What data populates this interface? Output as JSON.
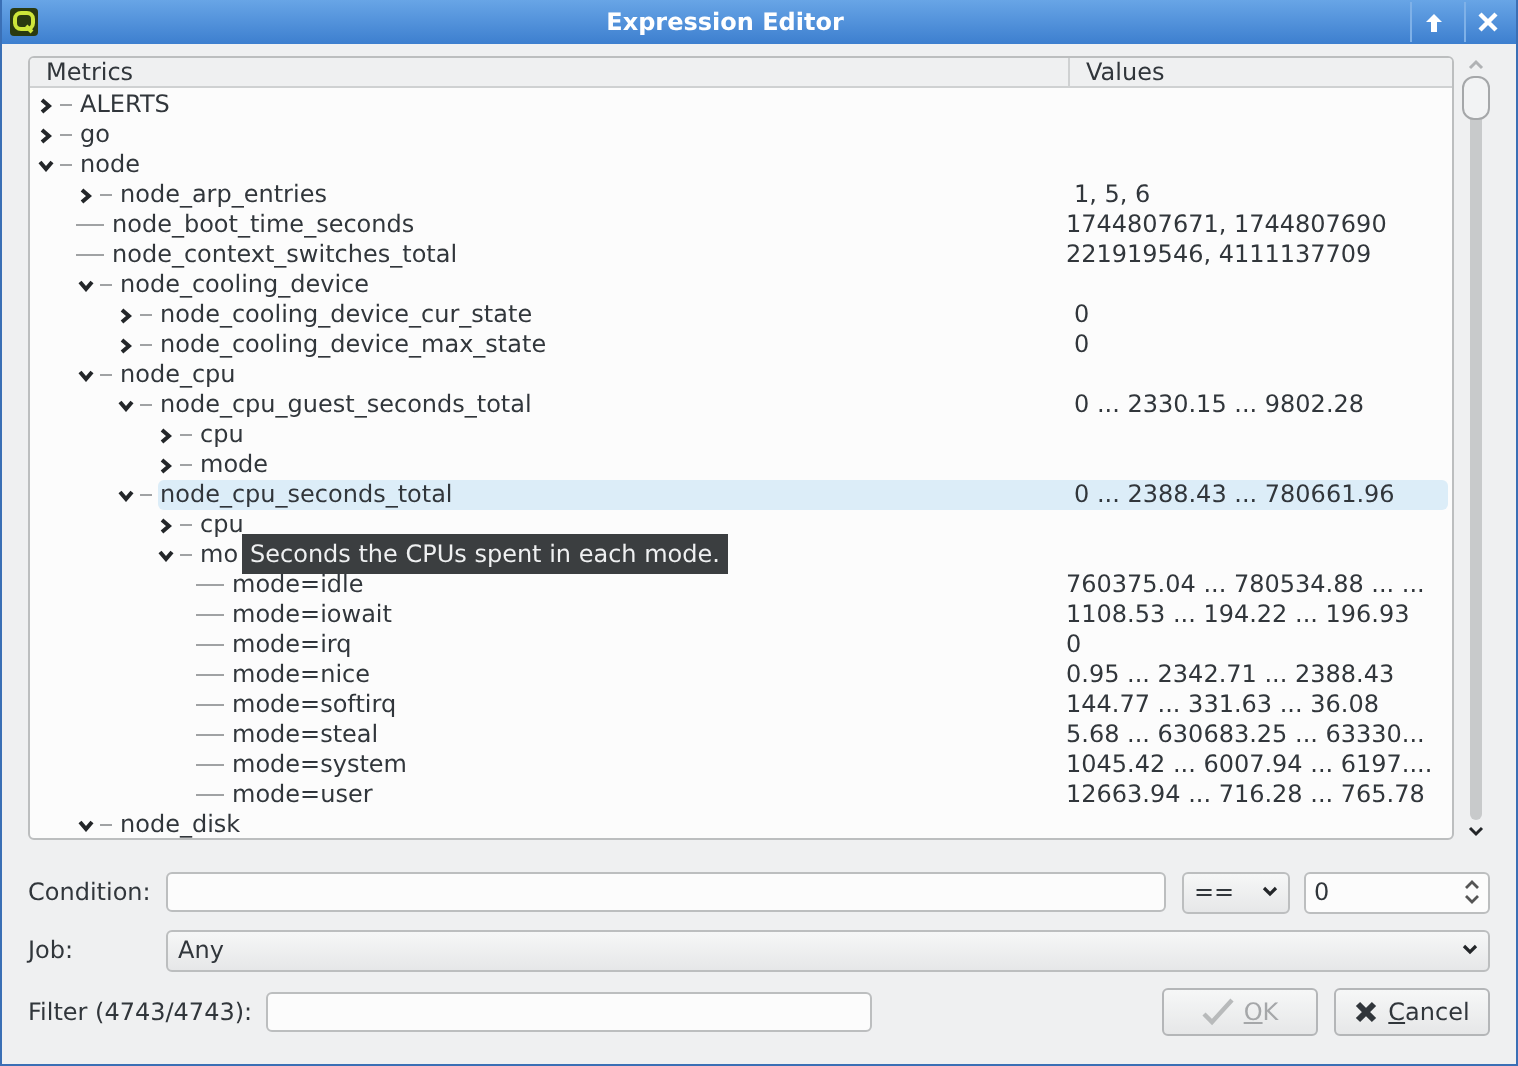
{
  "window": {
    "title": "Expression Editor"
  },
  "tree": {
    "columns": [
      "Metrics",
      "Values"
    ],
    "items": [
      {
        "label": "ALERTS",
        "expanded": false,
        "selected": false
      },
      {
        "label": "go",
        "expanded": false,
        "selected": false
      },
      {
        "label": "node",
        "expanded": true,
        "selected": false,
        "children": [
          {
            "label": "node_arp_entries",
            "value": "1, 5, 6",
            "expanded": false,
            "selected": false
          },
          {
            "label": "node_boot_time_seconds",
            "value": "1744807671, 1744807690",
            "selected": false
          },
          {
            "label": "node_context_switches_total",
            "value": "221919546, 4111137709",
            "selected": false
          },
          {
            "label": "node_cooling_device",
            "expanded": true,
            "selected": false,
            "children": [
              {
                "label": "node_cooling_device_cur_state",
                "value": "0",
                "expanded": false,
                "selected": false
              },
              {
                "label": "node_cooling_device_max_state",
                "value": "0",
                "expanded": false,
                "selected": false
              }
            ]
          },
          {
            "label": "node_cpu",
            "expanded": true,
            "selected": false,
            "children": [
              {
                "label": "node_cpu_guest_seconds_total",
                "value": "0 ... 2330.15 ... 9802.28",
                "expanded": true,
                "selected": false,
                "children": [
                  {
                    "label": "cpu",
                    "expanded": false,
                    "selected": false
                  },
                  {
                    "label": "mode",
                    "expanded": false,
                    "selected": false
                  }
                ]
              },
              {
                "label": "node_cpu_seconds_total",
                "value": "0 ... 2388.43 ... 780661.96",
                "expanded": true,
                "selected": true,
                "children": [
                  {
                    "label": "cpu",
                    "expanded": false,
                    "selected": false
                  },
                  {
                    "label": "mo",
                    "expanded": true,
                    "selected": false,
                    "children": [
                      {
                        "label": "mode=idle",
                        "value": "760375.04 ... 780534.88 ... ...",
                        "selected": false
                      },
                      {
                        "label": "mode=iowait",
                        "value": "1108.53 ... 194.22 ... 196.93",
                        "selected": false
                      },
                      {
                        "label": "mode=irq",
                        "value": "0",
                        "selected": false
                      },
                      {
                        "label": "mode=nice",
                        "value": "0.95 ... 2342.71 ... 2388.43",
                        "selected": false
                      },
                      {
                        "label": "mode=softirq",
                        "value": "144.77 ... 331.63 ... 36.08",
                        "selected": false
                      },
                      {
                        "label": "mode=steal",
                        "value": "5.68 ... 630683.25 ... 63330...",
                        "selected": false
                      },
                      {
                        "label": "mode=system",
                        "value": "1045.42 ... 6007.94 ... 6197....",
                        "selected": false
                      },
                      {
                        "label": "mode=user",
                        "value": "12663.94 ... 716.28 ... 765.78",
                        "selected": false
                      }
                    ]
                  }
                ]
              }
            ]
          },
          {
            "label": "node_disk",
            "expanded": true,
            "selected": false
          }
        ]
      }
    ],
    "tooltip": "Seconds the CPUs spent in each mode."
  },
  "condition": {
    "label": "Condition:",
    "operator": "==",
    "number": "0"
  },
  "job": {
    "label": "Job:",
    "value": "Any"
  },
  "filter": {
    "label": "Filter (4743/4743):"
  },
  "buttons": [
    {
      "label": "OK",
      "kind": "ok",
      "disabled": true
    },
    {
      "label": "Cancel",
      "kind": "cancel",
      "disabled": false
    }
  ]
}
